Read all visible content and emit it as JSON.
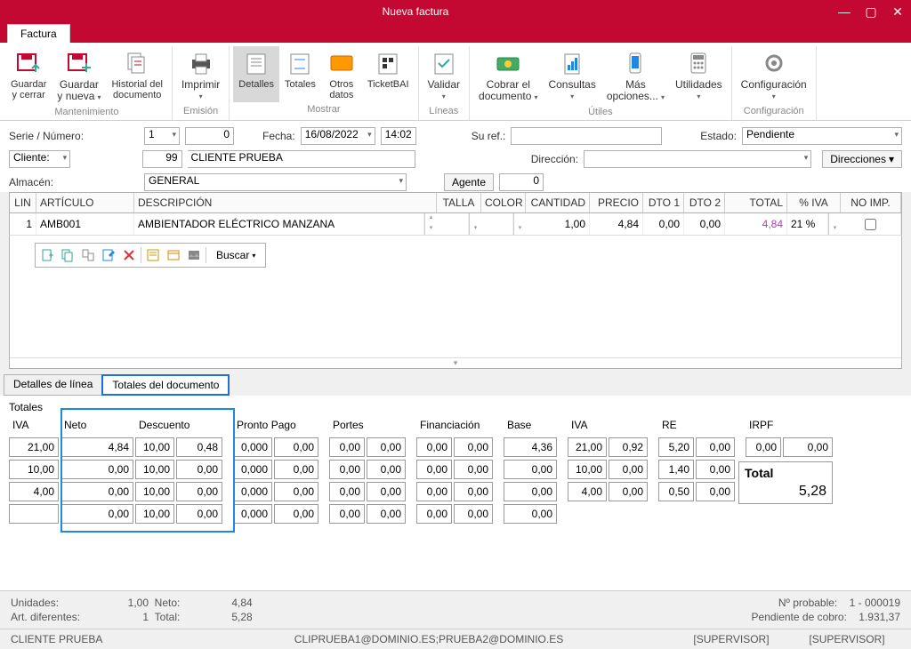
{
  "window": {
    "title": "Nueva factura"
  },
  "tab": "Factura",
  "ribbon": {
    "groups": [
      {
        "label": "Mantenimiento",
        "buttons": [
          {
            "label": "Guardar\ny cerrar",
            "caret": false
          },
          {
            "label": "Guardar\ny nueva",
            "caret": true
          },
          {
            "label": "Historial del\ndocumento",
            "caret": false
          }
        ]
      },
      {
        "label": "Emisión",
        "buttons": [
          {
            "label": "Imprimir",
            "caret": true
          }
        ]
      },
      {
        "label": "Mostrar",
        "buttons": [
          {
            "label": "Detalles",
            "active": true
          },
          {
            "label": "Totales"
          },
          {
            "label": "Otros\ndatos"
          },
          {
            "label": "TicketBAI"
          }
        ]
      },
      {
        "label": "Líneas",
        "buttons": [
          {
            "label": "Validar",
            "caret": true
          }
        ]
      },
      {
        "label": "Útiles",
        "buttons": [
          {
            "label": "Cobrar el\ndocumento",
            "caret": true
          },
          {
            "label": "Consultas",
            "caret": true
          },
          {
            "label": "Más\nopciones...",
            "caret": true
          },
          {
            "label": "Utilidades",
            "caret": true
          }
        ]
      },
      {
        "label": "Configuración",
        "buttons": [
          {
            "label": "Configuración",
            "caret": true
          }
        ]
      }
    ]
  },
  "form": {
    "serie_label": "Serie / Número:",
    "serie_val": "1",
    "num_val": "0",
    "fecha_label": "Fecha:",
    "fecha": "16/08/2022",
    "hora": "14:02",
    "suref_label": "Su ref.:",
    "suref": "",
    "estado_label": "Estado:",
    "estado": "Pendiente",
    "cliente_label": "Cliente:",
    "cliente_num": "99",
    "cliente_nom": "CLIENTE PRUEBA",
    "direccion_label": "Dirección:",
    "direcciones_btn": "Direcciones",
    "almacen_label": "Almacén:",
    "almacen": "GENERAL",
    "agente_btn": "Agente",
    "agente_val": "0"
  },
  "grid": {
    "headers": [
      "LIN",
      "ARTÍCULO",
      "DESCRIPCIÓN",
      "TALLA",
      "COLOR",
      "CANTIDAD",
      "PRECIO",
      "DTO 1",
      "DTO 2",
      "TOTAL",
      "% IVA",
      "NO IMP."
    ],
    "row": {
      "lin": "1",
      "art": "AMB001",
      "desc": "AMBIENTADOR ELÉCTRICO MANZANA",
      "talla": "",
      "color": "",
      "cant": "1,00",
      "precio": "4,84",
      "dto1": "0,00",
      "dto2": "0,00",
      "total": "4,84",
      "iva": "21 %",
      "noimp": false
    },
    "toolbar_search": "Buscar"
  },
  "subtabs": {
    "a": "Detalles de línea",
    "b": "Totales del documento"
  },
  "totals": {
    "title": "Totales",
    "cols": [
      "IVA",
      "Neto",
      "",
      "Descuento",
      "",
      "Pronto Pago",
      "",
      "Portes",
      "",
      "Financiación",
      "",
      "Base",
      "IVA",
      "",
      "RE",
      "",
      "IRPF",
      ""
    ],
    "rows": [
      {
        "iva": "21,00",
        "neto": "4,84",
        "dpct": "10,00",
        "dval": "0,48",
        "pp_p": "0,000",
        "pp_v": "0,00",
        "po_p": "0,00",
        "po_v": "0,00",
        "fi_p": "0,00",
        "fi_v": "0,00",
        "base": "4,36",
        "iva_p": "21,00",
        "iva_v": "0,92",
        "re_p": "5,20",
        "re_v": "0,00",
        "irpf_p": "0,00",
        "irpf_v": "0,00"
      },
      {
        "iva": "10,00",
        "neto": "0,00",
        "dpct": "10,00",
        "dval": "0,00",
        "pp_p": "0,000",
        "pp_v": "0,00",
        "po_p": "0,00",
        "po_v": "0,00",
        "fi_p": "0,00",
        "fi_v": "0,00",
        "base": "0,00",
        "iva_p": "10,00",
        "iva_v": "0,00",
        "re_p": "1,40",
        "re_v": "0,00"
      },
      {
        "iva": "4,00",
        "neto": "0,00",
        "dpct": "10,00",
        "dval": "0,00",
        "pp_p": "0,000",
        "pp_v": "0,00",
        "po_p": "0,00",
        "po_v": "0,00",
        "fi_p": "0,00",
        "fi_v": "0,00",
        "base": "0,00",
        "iva_p": "4,00",
        "iva_v": "0,00",
        "re_p": "0,50",
        "re_v": "0,00"
      },
      {
        "iva": "",
        "neto": "0,00",
        "dpct": "10,00",
        "dval": "0,00",
        "pp_p": "0,000",
        "pp_v": "0,00",
        "po_p": "0,00",
        "po_v": "0,00",
        "fi_p": "0,00",
        "fi_v": "0,00",
        "base": "0,00"
      }
    ],
    "total_label": "Total",
    "total_val": "5,28"
  },
  "footer": {
    "unidades_l": "Unidades:",
    "unidades": "1,00",
    "neto_l": "Neto:",
    "neto": "4,84",
    "artdif_l": "Art. diferentes:",
    "artdif": "1",
    "total_l": "Total:",
    "total": "5,28",
    "nprob_l": "Nº probable:",
    "nprob": "1 - 000019",
    "pend_l": "Pendiente de cobro:",
    "pend": "1.931,37"
  },
  "status": {
    "cliente": "CLIENTE PRUEBA",
    "email": "CLIPRUEBA1@DOMINIO.ES;PRUEBA2@DOMINIO.ES",
    "sup1": "[SUPERVISOR]",
    "sup2": "[SUPERVISOR]"
  }
}
